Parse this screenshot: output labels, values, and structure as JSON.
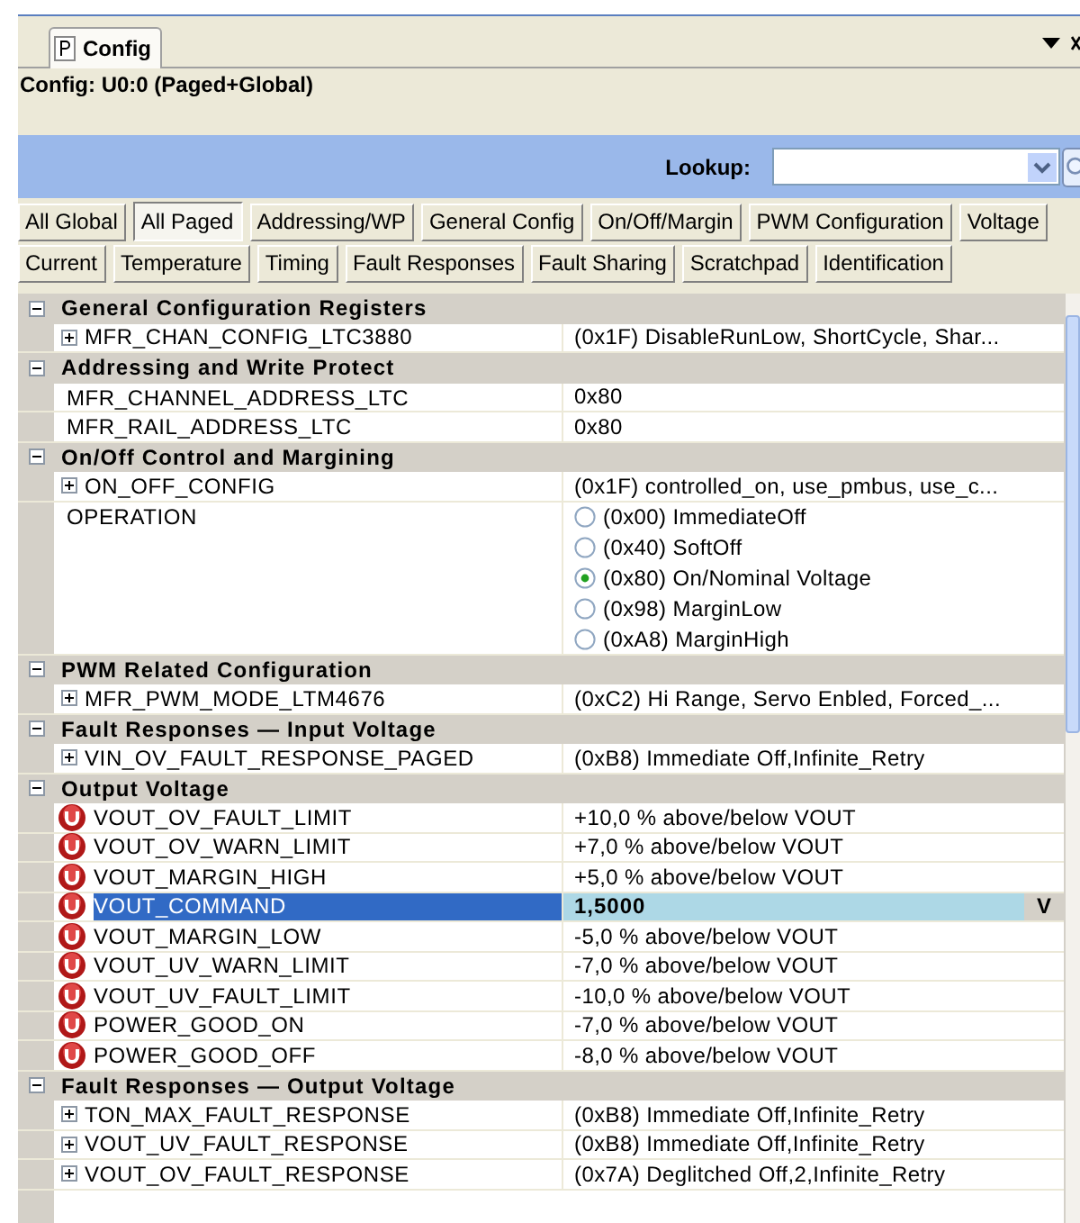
{
  "doc_tab": {
    "label": "Config",
    "selected": true
  },
  "title": "Config: U0:0 (Paged+Global)",
  "lookup": {
    "label": "Lookup:"
  },
  "filter_buttons": [
    [
      {
        "label": "All Global",
        "selected": false
      },
      {
        "label": "All Paged",
        "selected": true
      },
      {
        "label": "Addressing/WP",
        "selected": false
      },
      {
        "label": "General Config",
        "selected": false
      },
      {
        "label": "On/Off/Margin",
        "selected": false
      },
      {
        "label": "PWM Configuration",
        "selected": false
      },
      {
        "label": "Voltage",
        "selected": false
      }
    ],
    [
      {
        "label": "Current",
        "selected": false
      },
      {
        "label": "Temperature",
        "selected": false
      },
      {
        "label": "Timing",
        "selected": false
      },
      {
        "label": "Fault Responses",
        "selected": false
      },
      {
        "label": "Fault Sharing",
        "selected": false
      },
      {
        "label": "Scratchpad",
        "selected": false
      },
      {
        "label": "Identification",
        "selected": false
      }
    ]
  ],
  "sections": [
    {
      "title": "General Configuration Registers",
      "expanded": true,
      "rows": [
        {
          "kind": "expandable",
          "expanded": false,
          "name": "MFR_CHAN_CONFIG_LTC3880",
          "value": "(0x1F)  DisableRunLow, ShortCycle, Shar..."
        }
      ]
    },
    {
      "title": "Addressing and Write Protect",
      "expanded": true,
      "rows": [
        {
          "kind": "plain",
          "name": "MFR_CHANNEL_ADDRESS_LTC",
          "value": "0x80"
        },
        {
          "kind": "plain",
          "name": "MFR_RAIL_ADDRESS_LTC",
          "value": "0x80"
        }
      ]
    },
    {
      "title": "On/Off Control and Margining",
      "expanded": true,
      "rows": [
        {
          "kind": "expandable",
          "expanded": false,
          "name": "ON_OFF_CONFIG",
          "value": "(0x1F)  controlled_on, use_pmbus, use_c..."
        },
        {
          "kind": "radio",
          "name": "OPERATION",
          "options": [
            {
              "label": "(0x00) ImmediateOff",
              "selected": false
            },
            {
              "label": "(0x40) SoftOff",
              "selected": false
            },
            {
              "label": "(0x80) On/Nominal Voltage",
              "selected": true
            },
            {
              "label": "(0x98) MarginLow",
              "selected": false
            },
            {
              "label": "(0xA8) MarginHigh",
              "selected": false
            }
          ]
        }
      ]
    },
    {
      "title": "PWM Related Configuration",
      "expanded": true,
      "rows": [
        {
          "kind": "expandable",
          "expanded": false,
          "name": "MFR_PWM_MODE_LTM4676",
          "value": "(0xC2) Hi Range, Servo Enbled, Forced_..."
        }
      ]
    },
    {
      "title": "Fault Responses — Input Voltage",
      "expanded": true,
      "rows": [
        {
          "kind": "expandable",
          "expanded": false,
          "name": "VIN_OV_FAULT_RESPONSE_PAGED",
          "value": "(0xB8) Immediate Off,Infinite_Retry"
        }
      ]
    },
    {
      "title": "Output Voltage",
      "expanded": true,
      "rows": [
        {
          "kind": "unit",
          "selected": false,
          "name": "VOUT_OV_FAULT_LIMIT",
          "value": "+10,0 % above/below VOUT"
        },
        {
          "kind": "unit",
          "selected": false,
          "name": "VOUT_OV_WARN_LIMIT",
          "value": "+7,0 % above/below VOUT"
        },
        {
          "kind": "unit",
          "selected": false,
          "name": "VOUT_MARGIN_HIGH",
          "value": "+5,0 % above/below VOUT"
        },
        {
          "kind": "unit",
          "selected": true,
          "name": "VOUT_COMMAND",
          "value": "1,5000",
          "editor_unit": "V"
        },
        {
          "kind": "unit",
          "selected": false,
          "name": "VOUT_MARGIN_LOW",
          "value": "-5,0 % above/below VOUT"
        },
        {
          "kind": "unit",
          "selected": false,
          "name": "VOUT_UV_WARN_LIMIT",
          "value": "-7,0 % above/below VOUT"
        },
        {
          "kind": "unit",
          "selected": false,
          "name": "VOUT_UV_FAULT_LIMIT",
          "value": "-10,0 % above/below VOUT"
        },
        {
          "kind": "unit",
          "selected": false,
          "name": "POWER_GOOD_ON",
          "value": "-7,0 % above/below VOUT"
        },
        {
          "kind": "unit",
          "selected": false,
          "name": "POWER_GOOD_OFF",
          "value": "-8,0 % above/below VOUT"
        }
      ]
    },
    {
      "title": "Fault Responses — Output Voltage",
      "expanded": true,
      "rows": [
        {
          "kind": "expandable",
          "expanded": false,
          "name": "TON_MAX_FAULT_RESPONSE",
          "value": "(0xB8) Immediate Off,Infinite_Retry"
        },
        {
          "kind": "expandable",
          "expanded": false,
          "name": "VOUT_UV_FAULT_RESPONSE",
          "value": "(0xB8) Immediate Off,Infinite_Retry"
        },
        {
          "kind": "expandable",
          "expanded": false,
          "name": "VOUT_OV_FAULT_RESPONSE",
          "value": "(0x7A) Deglitched Off,2,Infinite_Retry"
        }
      ]
    }
  ]
}
